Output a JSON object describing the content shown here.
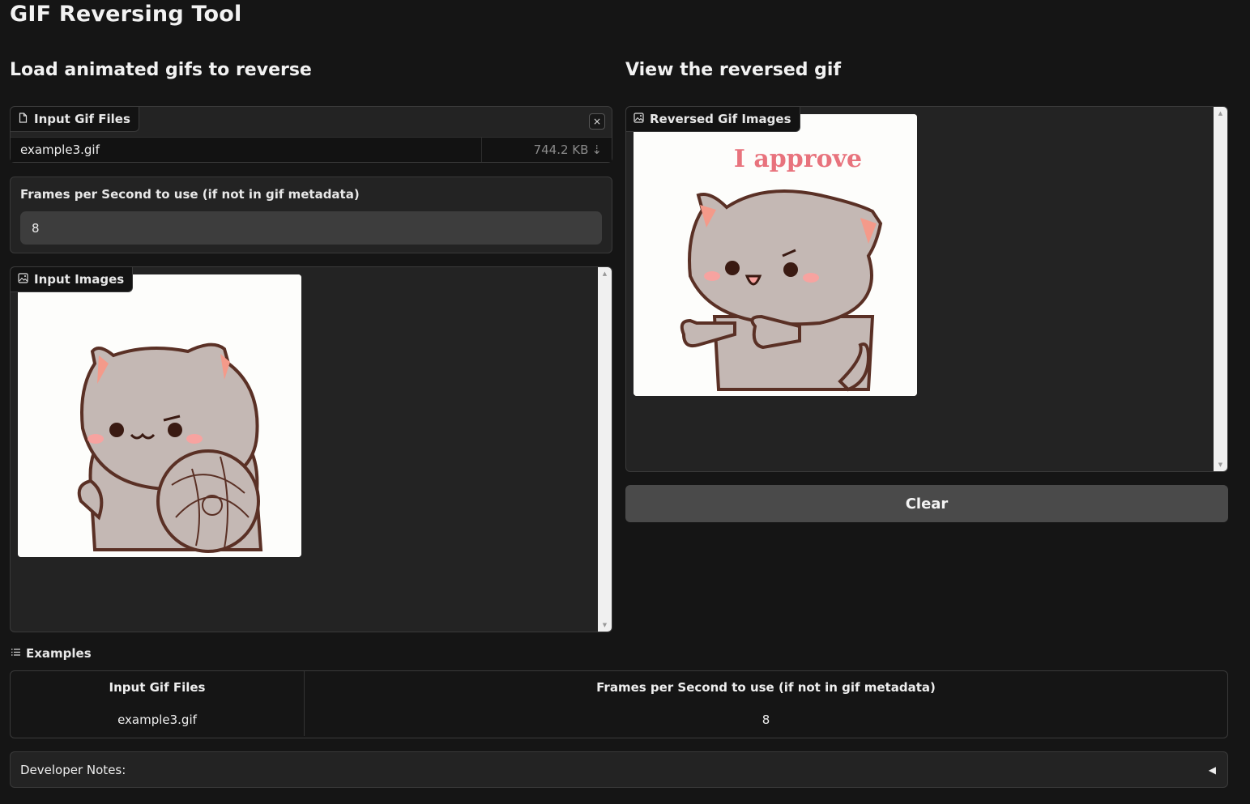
{
  "app": {
    "title": "GIF Reversing Tool"
  },
  "left": {
    "heading": "Load animated gifs to reverse",
    "file_input": {
      "label": "Input Gif Files",
      "close_glyph": "×",
      "file_name": "example3.gif",
      "file_size": "744.2 KB",
      "download_glyph": "⇣"
    },
    "fps": {
      "label": "Frames per Second to use (if not in gif metadata)",
      "value": "8"
    },
    "input_images": {
      "label": "Input Images"
    }
  },
  "right": {
    "heading": "View the reversed gif",
    "output_images": {
      "label": "Reversed Gif Images",
      "caption": "I approve"
    },
    "clear_button": "Clear"
  },
  "examples": {
    "label": "Examples",
    "headers": [
      "Input Gif Files",
      "Frames per Second to use (if not in gif metadata)"
    ],
    "rows": [
      [
        "example3.gif",
        "8"
      ]
    ]
  },
  "developer_notes": {
    "label": "Developer Notes:",
    "toggle_glyph": "◀"
  },
  "icons": {
    "file": "file-icon",
    "image": "image-icon",
    "list": "list-icon",
    "close": "close-icon",
    "download": "download-arrow-icon",
    "collapse": "triangle-left-icon"
  },
  "colors": {
    "background": "#151515",
    "panel": "#232323",
    "button": "#4a4a4a",
    "cat_fur": "#c4b8b4",
    "cat_cheek": "#f7a3a0",
    "caption": "#e8737d"
  }
}
